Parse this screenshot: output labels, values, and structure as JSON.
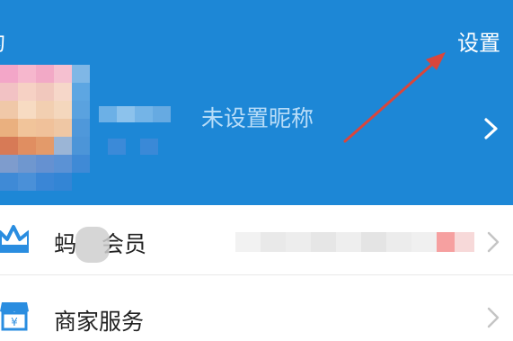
{
  "header": {
    "title": "的",
    "settings_label": "设置",
    "nickname": "未设置昵称"
  },
  "menu": [
    {
      "label_prefix": "蚂",
      "label": "会员"
    },
    {
      "label": "商家服务"
    }
  ],
  "colors": {
    "header_bg": "#1d87d6",
    "arrow": "#d9463c",
    "chevron": "#c4c4c4",
    "vip_icon": "#2a8de0"
  },
  "icons": [
    "chevron-right-icon",
    "crown-icon",
    "store-icon"
  ]
}
